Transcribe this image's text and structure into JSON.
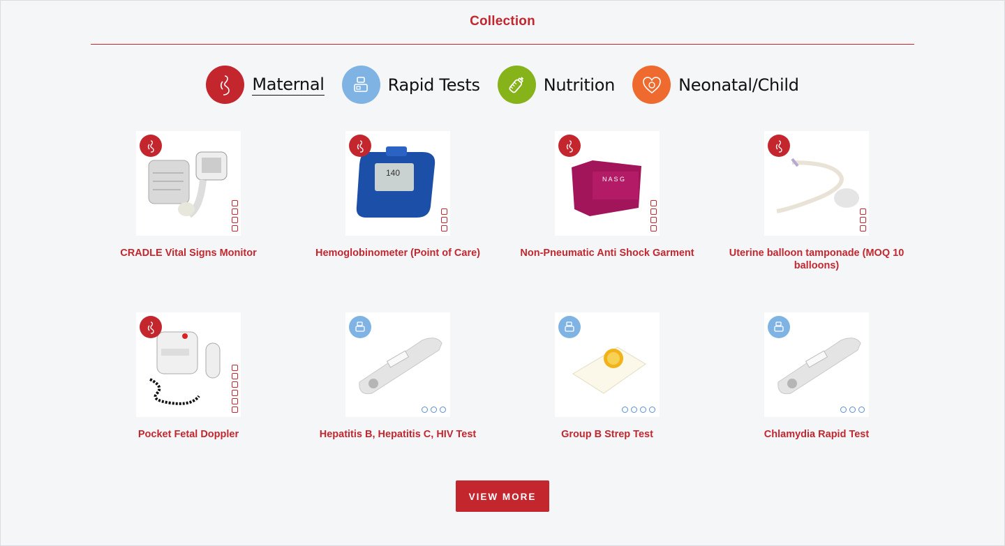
{
  "page_title": "Collection",
  "categories": [
    {
      "label": "Maternal",
      "icon": "pregnant-woman-icon",
      "color": "#c4262e",
      "active": true
    },
    {
      "label": "Rapid Tests",
      "icon": "rapid-test-icon",
      "color": "#7fb3e3",
      "active": false
    },
    {
      "label": "Nutrition",
      "icon": "baby-bottle-icon",
      "color": "#86b21a",
      "active": false
    },
    {
      "label": "Neonatal/Child",
      "icon": "baby-heart-icon",
      "color": "#ee6a2e",
      "active": false
    }
  ],
  "products": [
    {
      "name": "CRADLE Vital Signs Monitor",
      "category": "maternal"
    },
    {
      "name": "Hemoglobinometer (Point of Care)",
      "category": "maternal"
    },
    {
      "name": "Non-Pneumatic Anti Shock Garment",
      "category": "maternal"
    },
    {
      "name": "Uterine balloon tamponade (MOQ 10 balloons)",
      "category": "maternal"
    },
    {
      "name": "Pocket Fetal Doppler",
      "category": "maternal"
    },
    {
      "name": "Hepatitis B, Hepatitis C, HIV Test",
      "category": "rapid-tests"
    },
    {
      "name": "Group B Strep Test",
      "category": "rapid-tests"
    },
    {
      "name": "Chlamydia Rapid Test",
      "category": "rapid-tests"
    }
  ],
  "view_more_label": "VIEW MORE",
  "colors": {
    "brand_red": "#c4262e",
    "rapid_blue": "#7fb3e3",
    "nutrition_green": "#86b21a",
    "neonatal_orange": "#ee6a2e"
  }
}
